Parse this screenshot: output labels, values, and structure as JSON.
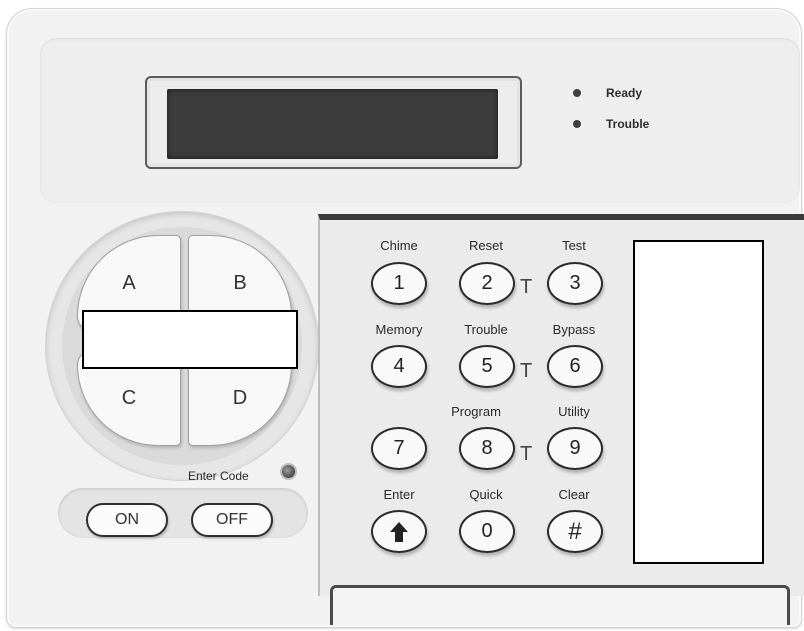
{
  "status": {
    "ready_label": "Ready",
    "trouble_label": "Trouble"
  },
  "dial": {
    "a_label": "A",
    "b_label": "B",
    "c_label": "C",
    "d_label": "D"
  },
  "enter_code_label": "Enter Code",
  "on_label": "ON",
  "off_label": "OFF",
  "keys": {
    "k1": {
      "func": "Chime",
      "digit": "1"
    },
    "k2": {
      "func": "Reset",
      "digit": "2"
    },
    "k3": {
      "func": "Test",
      "digit": "3"
    },
    "k4": {
      "func": "Memory",
      "digit": "4"
    },
    "k5": {
      "func": "Trouble",
      "digit": "5"
    },
    "k6": {
      "func": "Bypass",
      "digit": "6"
    },
    "k7": {
      "func": "",
      "digit": "7"
    },
    "k8": {
      "func": "Program",
      "digit": "8"
    },
    "k9": {
      "func": "Utility",
      "digit": "9"
    },
    "kenter": {
      "func": "Enter",
      "digit": ""
    },
    "k0": {
      "func": "Quick",
      "digit": "0"
    },
    "khash": {
      "func": "Clear",
      "digit": "#"
    }
  },
  "tie_mark": "T",
  "colors": {
    "panel": "#f2f2f2",
    "lcd": "#3c3c3c",
    "key_border": "#2b2b2b"
  }
}
